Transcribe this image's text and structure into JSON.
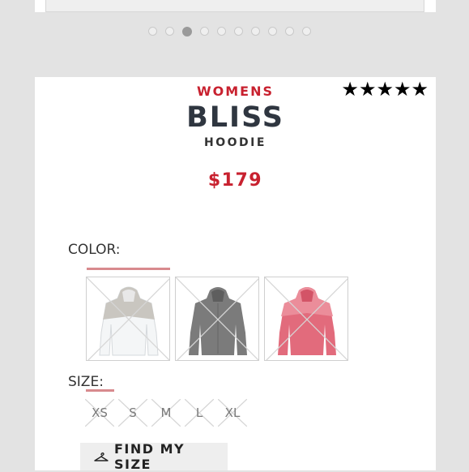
{
  "carousel": {
    "dot_count": 10,
    "active_index": 2
  },
  "product": {
    "gender": "WOMENS",
    "name": "BLISS",
    "type": "HOODIE",
    "price": "$179",
    "rating": 5
  },
  "color": {
    "label": "COLOR:",
    "swatches": [
      {
        "name": "white",
        "body": "#f4f6f7",
        "accent": "#c9c6c0"
      },
      {
        "name": "grey",
        "body": "#7b7b7b",
        "accent": "#6a6a6a"
      },
      {
        "name": "pink",
        "body": "#e26b7c",
        "accent": "#eb8d9a"
      }
    ]
  },
  "size": {
    "label": "SIZE:",
    "options": [
      "XS",
      "S",
      "M",
      "L",
      "XL"
    ]
  },
  "find_size": {
    "label": "FIND MY SIZE",
    "icon": "hanger-icon"
  },
  "colors": {
    "brand_red": "#c8212f",
    "title_dark": "#2f3640"
  }
}
